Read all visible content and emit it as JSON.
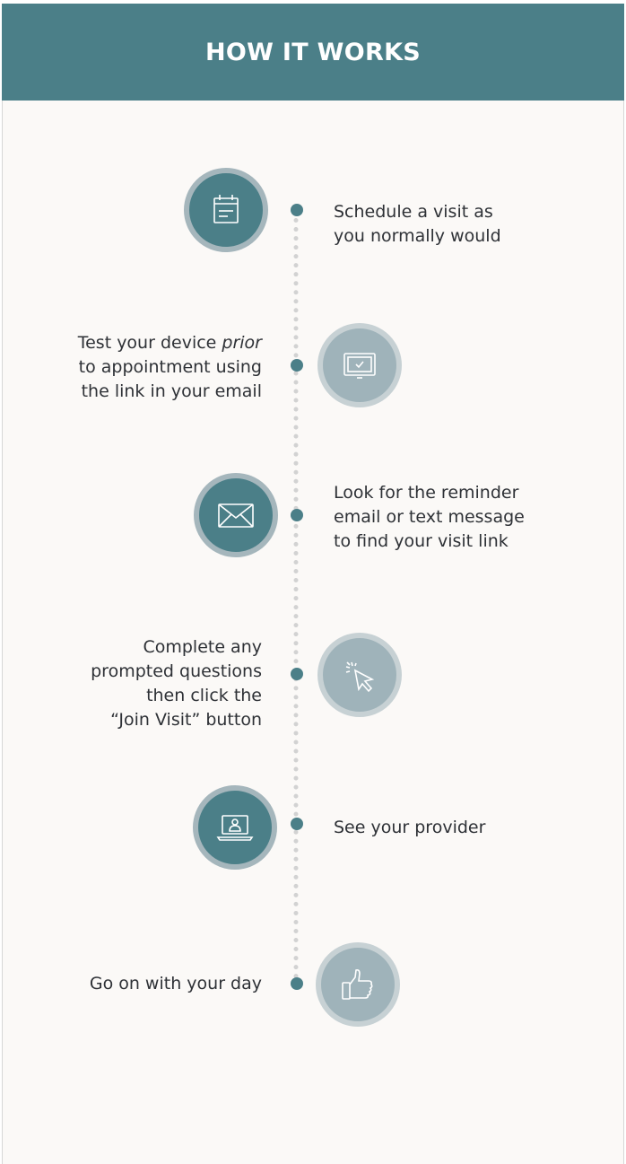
{
  "header": {
    "title": "HOW IT WORKS"
  },
  "steps": [
    {
      "line1": "Schedule a visit as",
      "line2": "you normally would",
      "icon": "calendar-icon"
    },
    {
      "line1_pre": "Test your device ",
      "line1_em": "prior",
      "line2": "to appointment using",
      "line3": "the link in your email",
      "icon": "tablet-check-icon"
    },
    {
      "line1": "Look for the reminder",
      "line2": "email or text message",
      "line3": "to find your visit link",
      "icon": "envelope-icon"
    },
    {
      "line1": "Complete any",
      "line2": "prompted questions",
      "line3": "then click the",
      "line4": "“Join Visit” button",
      "icon": "cursor-click-icon"
    },
    {
      "line1": "See your provider",
      "icon": "laptop-user-icon"
    },
    {
      "line1": "Go on with your day",
      "icon": "thumbs-up-icon"
    }
  ],
  "colors": {
    "teal": "#4b7f88",
    "light_circle": "#9fb3ba",
    "ring": "#a5b6bc",
    "background": "#fbf9f7"
  }
}
